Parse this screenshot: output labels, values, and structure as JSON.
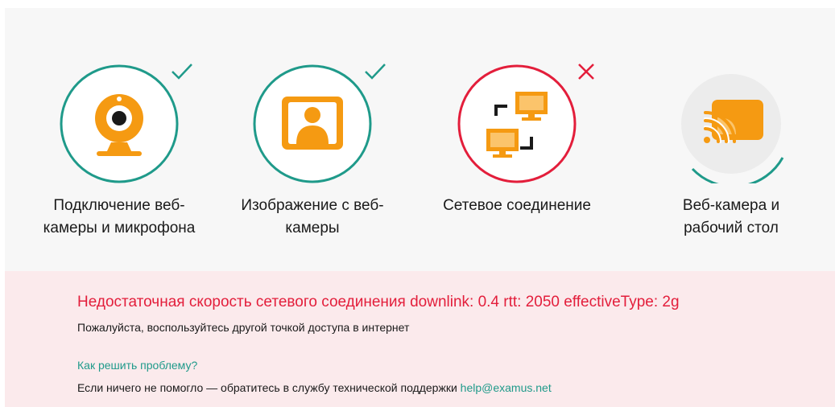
{
  "steps": [
    {
      "label": "Подключение веб-\nкамеры и микрофона",
      "status": "ok",
      "icon": "webcam-icon"
    },
    {
      "label": "Изображение с веб-\nкамеры",
      "status": "ok",
      "icon": "user-portrait-icon"
    },
    {
      "label": "Сетевое соединение",
      "status": "error",
      "icon": "network-icon"
    },
    {
      "label": "Веб-камера и\nрабочий стол",
      "status": "pending",
      "icon": "screencast-icon"
    }
  ],
  "alert": {
    "title": "Недостаточная скорость сетевого соединения downlink: 0.4 rtt: 2050 effectiveType: 2g",
    "subtitle": "Пожалуйста, воспользуйтесь другой точкой доступа в интернет",
    "howto_link": "Как решить проблему?",
    "contact_text": "Если ничего не помогло — обратитесь в службу технической поддержки ",
    "contact_email": "help@examus.net"
  },
  "colors": {
    "ok": "#1f9a8a",
    "error": "#e31e3b",
    "icon": "#f59a12",
    "alert_bg": "#fbeaec"
  }
}
